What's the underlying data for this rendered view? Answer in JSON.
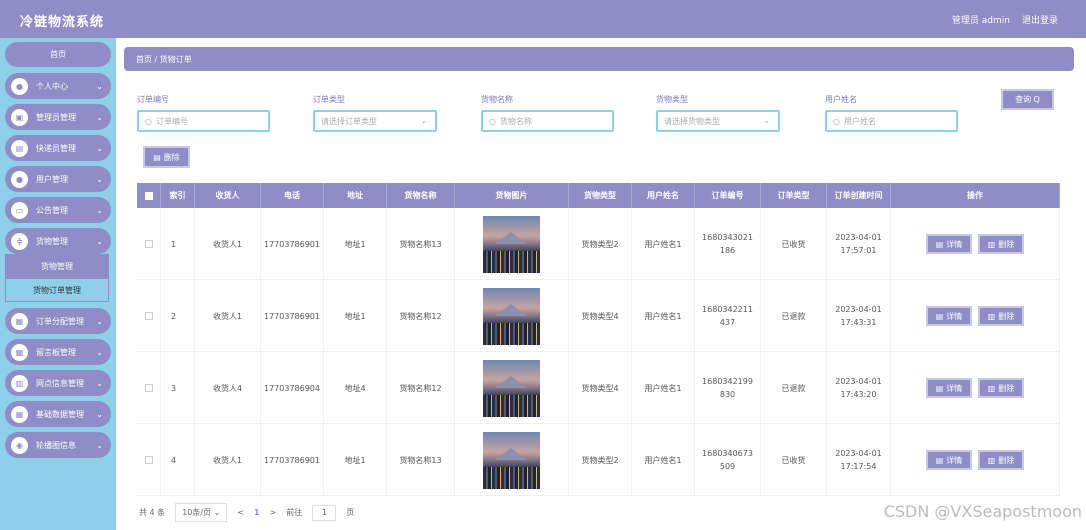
{
  "header": {
    "title": "冷链物流系统",
    "user": "管理员 admin",
    "logout": "退出登录"
  },
  "sidebar": {
    "home": "首页",
    "items": [
      {
        "label": "个人中心",
        "icon": "user-icon"
      },
      {
        "label": "管理员管理",
        "icon": "briefcase-icon"
      },
      {
        "label": "快递员管理",
        "icon": "lock-icon"
      },
      {
        "label": "用户管理",
        "icon": "user-icon"
      },
      {
        "label": "公告管理",
        "icon": "notice-icon"
      },
      {
        "label": "货物管理",
        "icon": "goods-icon"
      }
    ],
    "sub": [
      "货物管理",
      "货物订单管理"
    ],
    "items2": [
      {
        "label": "订单分配管理",
        "icon": "grid-icon"
      },
      {
        "label": "留言板管理",
        "icon": "grid-icon"
      },
      {
        "label": "网点信息管理",
        "icon": "chart-icon"
      },
      {
        "label": "基础数据管理",
        "icon": "grid-icon"
      },
      {
        "label": "轮播图信息",
        "icon": "pin-icon"
      }
    ]
  },
  "breadcrumb": "首页 / 货物订单",
  "filters": [
    {
      "label": "订单编号",
      "placeholder": "订单编号",
      "type": "input"
    },
    {
      "label": "订单类型",
      "placeholder": "请选择订单类型",
      "type": "select"
    },
    {
      "label": "货物名称",
      "placeholder": "货物名称",
      "type": "input"
    },
    {
      "label": "货物类型",
      "placeholder": "请选择货物类型",
      "type": "select"
    },
    {
      "label": "用户姓名",
      "placeholder": "用户姓名",
      "type": "input"
    }
  ],
  "query_btn": "查询 Q",
  "delete_btn": "删除",
  "table": {
    "headers": [
      "索引",
      "收货人",
      "电话",
      "地址",
      "货物名称",
      "货物图片",
      "货物类型",
      "用户姓名",
      "订单编号",
      "订单类型",
      "订单创建时间",
      "操作"
    ],
    "rows": [
      {
        "idx": "1",
        "receiver": "收货人1",
        "phone": "17703786901",
        "addr": "地址1",
        "goods": "货物名称13",
        "gtype": "货物类型2",
        "user": "用户姓名1",
        "order": "1680343021186",
        "otype": "已收货",
        "time": "2023-04-01 17:57:01"
      },
      {
        "idx": "2",
        "receiver": "收货人1",
        "phone": "17703786901",
        "addr": "地址1",
        "goods": "货物名称12",
        "gtype": "货物类型4",
        "user": "用户姓名1",
        "order": "1680342211437",
        "otype": "已退款",
        "time": "2023-04-01 17:43:31"
      },
      {
        "idx": "3",
        "receiver": "收货人4",
        "phone": "17703786904",
        "addr": "地址4",
        "goods": "货物名称12",
        "gtype": "货物类型4",
        "user": "用户姓名1",
        "order": "1680342199830",
        "otype": "已退款",
        "time": "2023-04-01 17:43:20"
      },
      {
        "idx": "4",
        "receiver": "收货人1",
        "phone": "17703786901",
        "addr": "地址1",
        "goods": "货物名称13",
        "gtype": "货物类型2",
        "user": "用户姓名1",
        "order": "1680340673509",
        "otype": "已收货",
        "time": "2023-04-01 17:17:54"
      }
    ],
    "detail_btn": "详情",
    "del_btn": "删除"
  },
  "pager": {
    "total": "共 4 条",
    "size": "10条/页",
    "prev": "<",
    "page": "1",
    "next": ">",
    "goto": "前往",
    "goto_val": "1",
    "suffix": "页"
  },
  "watermark": "CSDN @VXSeapostmoon"
}
